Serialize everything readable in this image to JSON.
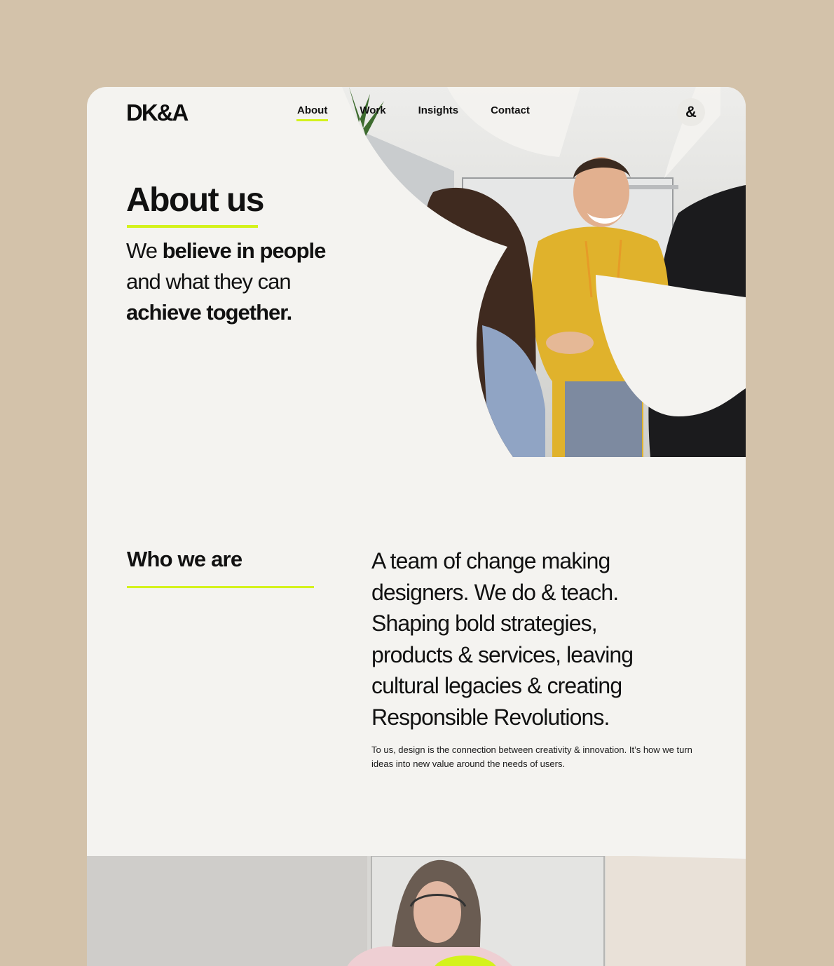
{
  "header": {
    "logo": "DK&A",
    "nav": [
      {
        "label": "About",
        "active": true
      },
      {
        "label": "Work",
        "active": false
      },
      {
        "label": "Insights",
        "active": false
      },
      {
        "label": "Contact",
        "active": false
      }
    ],
    "brand_icon": "&"
  },
  "hero": {
    "title": "About us",
    "subtitle_parts": {
      "p1": "We ",
      "p2": "believe in people",
      "p3": " and what they can ",
      "p4": "achieve together."
    }
  },
  "who": {
    "title": "Who we are",
    "lead": "A team of change making designers. We do & teach. Shaping bold strategies, products & services, leaving cultural legacies & creating Responsible Revolutions.",
    "body": "To us, design is the connection between creativity & innovation. It’s how we turn ideas into new value around the needs of users."
  },
  "colors": {
    "background": "#d3c2aa",
    "card": "#f4f3f0",
    "accent": "#d4f21c",
    "text": "#111111"
  }
}
